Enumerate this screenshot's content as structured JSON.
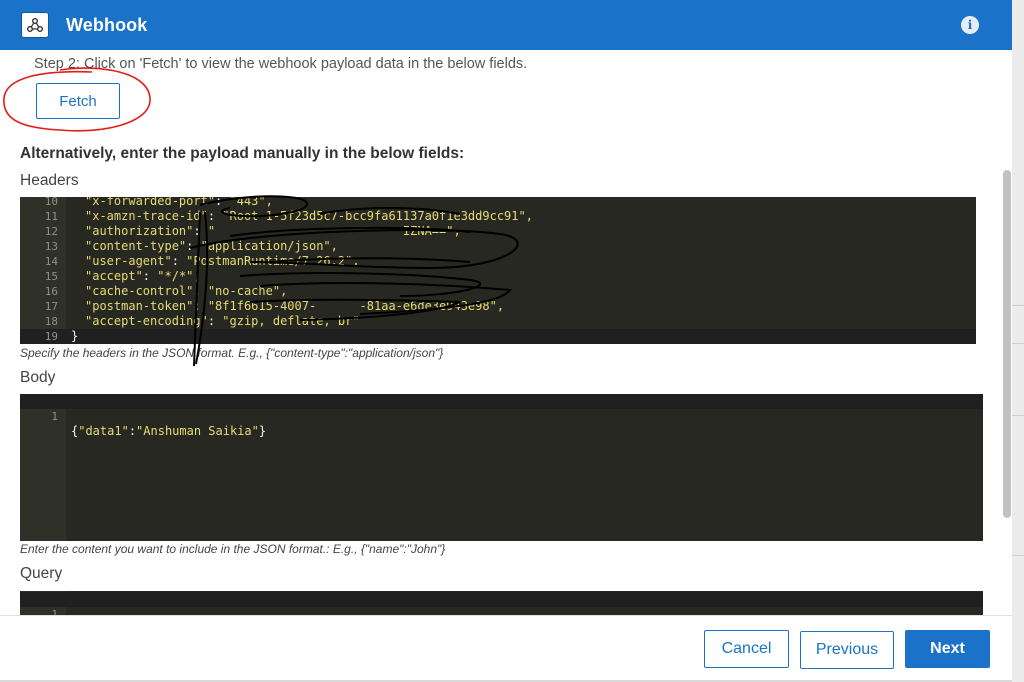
{
  "header": {
    "title": "Webhook",
    "logo_icon": "webhook-icon",
    "info_icon": "info-icon",
    "color": "#1a73c8"
  },
  "step": {
    "text": "Step 2: Click on 'Fetch' to view the webhook payload data in the below fields.",
    "fetch_label": "Fetch"
  },
  "alternative_text": "Alternatively, enter the payload manually in the below fields:",
  "headers_section": {
    "label": "Headers",
    "hint": "Specify the headers in the JSON format. E.g., {\"content-type\":\"application/json\"}",
    "lines": [
      {
        "num": "10",
        "key": "\"x-forwarded-port\"",
        "sep": ": ",
        "val": "\"443\","
      },
      {
        "num": "11",
        "key": "\"x-amzn-trace-id\"",
        "sep": ": ",
        "val": "\"Root-1-5f23d5c7-bcc9fa61137a0f1e3dd9cc91\","
      },
      {
        "num": "12",
        "key": "\"authorization\"",
        "sep": ": ",
        "val": "\"                          IZNA==\","
      },
      {
        "num": "13",
        "key": "\"content-type\"",
        "sep": ": ",
        "val": "\"application/json\","
      },
      {
        "num": "14",
        "key": "\"user-agent\"",
        "sep": ": ",
        "val": "\"PostmanRuntime/7.26.2\","
      },
      {
        "num": "15",
        "key": "\"accept\"",
        "sep": ": ",
        "val": "\"*/*\","
      },
      {
        "num": "16",
        "key": "\"cache-control\"",
        "sep": ": ",
        "val": "\"no-cache\","
      },
      {
        "num": "17",
        "key": "\"postman-token\"",
        "sep": ": ",
        "val": "\"8f1f6615-4007-      -81aa-e6de3e943e98\","
      },
      {
        "num": "18",
        "key": "\"accept-encoding\"",
        "sep": ": ",
        "val": "\"gzip, deflate, br\""
      },
      {
        "num": "19",
        "key": "}",
        "sep": "",
        "val": ""
      }
    ]
  },
  "body_section": {
    "label": "Body",
    "hint": "Enter the content you want to include in the JSON format.: E.g., {\"name\":\"John\"}",
    "line_num": "1",
    "open": "{",
    "key": "\"data1\"",
    "colon": ":",
    "value": "\"Anshuman Saikia\"",
    "close": "}"
  },
  "query_section": {
    "label": "Query",
    "line_num": "1",
    "code": "{}"
  },
  "footer": {
    "cancel": "Cancel",
    "previous": "Previous",
    "next": "Next"
  }
}
